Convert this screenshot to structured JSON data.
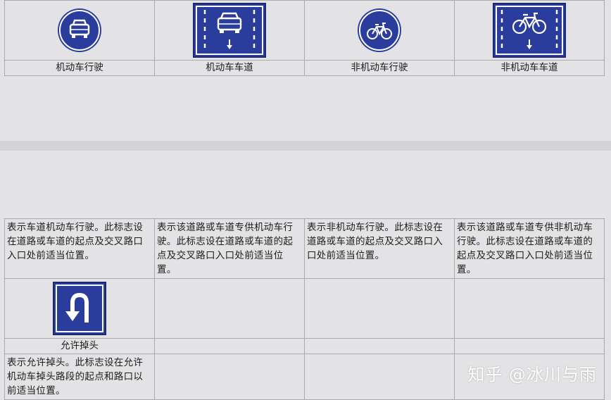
{
  "colors": {
    "sign_blue": "#2a3c9c",
    "sign_border": "#ffffff",
    "grid_line": "#a9aaae",
    "background": "#e3e3e5"
  },
  "top_row": [
    {
      "label": "机动车行驶",
      "icon": "car-circle-sign-icon"
    },
    {
      "label": "机动车车道",
      "icon": "car-lane-sign-icon"
    },
    {
      "label": "非机动车行驶",
      "icon": "bicycle-circle-sign-icon"
    },
    {
      "label": "非机动车车道",
      "icon": "bicycle-lane-sign-icon"
    }
  ],
  "descriptions": [
    "表示车道机动车行驶。此标志设在道路或车道的起点及交叉路口入口处前适当位置。",
    "表示该道路或车道专供机动车行驶。此标志设在道路或车道的起点及交叉路口入口处前适当位置。",
    "表示非机动车行驶。此标志设在道路或车道的起点及交叉路口入口处前适当位置。",
    "表示该道路或车道专供非机动车行驶。此标志设在道路或车道的起点及交叉路口入口处前适当位置。"
  ],
  "u_turn": {
    "label": "允许掉头",
    "icon": "u-turn-sign-icon",
    "description": "表示允许掉头。此标志设在允许机动车掉头路段的起点和路口以前适当位置。"
  },
  "watermark": "知乎 @冰川与雨"
}
